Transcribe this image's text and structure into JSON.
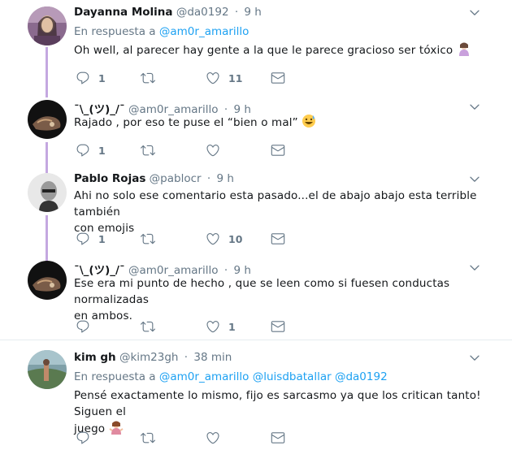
{
  "tweets": [
    {
      "name": "Dayanna Molina",
      "handle": "@da0192",
      "time": "9 h",
      "reply_prefix": "En respuesta a",
      "reply_to": [
        "@am0r_amarillo"
      ],
      "text": "Oh well, al parecer hay gente a la que le parece gracioso ser tóxico",
      "replies": "1",
      "retweets": "",
      "likes": "11"
    },
    {
      "name": "¯\\_(ツ)_/¯",
      "handle": "@am0r_amarillo",
      "time": "9 h",
      "text": "Rajado , por eso te puse el “bien o mal”",
      "replies": "1",
      "retweets": "",
      "likes": ""
    },
    {
      "name": "Pablo Rojas",
      "handle": "@pablocr",
      "time": "9 h",
      "text_line1": "Ahi no solo ese comentario esta pasado...el de abajo abajo esta terrible también",
      "text_line2": "con emojis",
      "replies": "1",
      "retweets": "",
      "likes": "10"
    },
    {
      "name": "¯\\_(ツ)_/¯",
      "handle": "@am0r_amarillo",
      "time": "9 h",
      "text_line1": "Ese era mi punto de hecho , que se leen como si fuesen conductas  normalizadas",
      "text_line2": "en ambos.",
      "replies": "",
      "retweets": "",
      "likes": "1"
    },
    {
      "name": "kim gh",
      "handle": "@kim23gh",
      "time": "38 min",
      "reply_prefix": "En respuesta a",
      "reply_to": [
        "@am0r_amarillo",
        "@luisdbatallar",
        "@da0192"
      ],
      "text_line1": "Pensé exactamente lo mismo, fijo es sarcasmo ya que los critican tanto! Siguen el",
      "text_line2": "juego",
      "replies": "",
      "retweets": "",
      "likes": ""
    }
  ],
  "colors": {
    "accent": "#1da1f2",
    "muted": "#657786",
    "thread_line": "#c4a8e0",
    "divider": "#e6ecf0"
  },
  "icons": [
    "reply-icon",
    "retweet-icon",
    "like-icon",
    "dm-icon",
    "chevron-down-icon"
  ]
}
